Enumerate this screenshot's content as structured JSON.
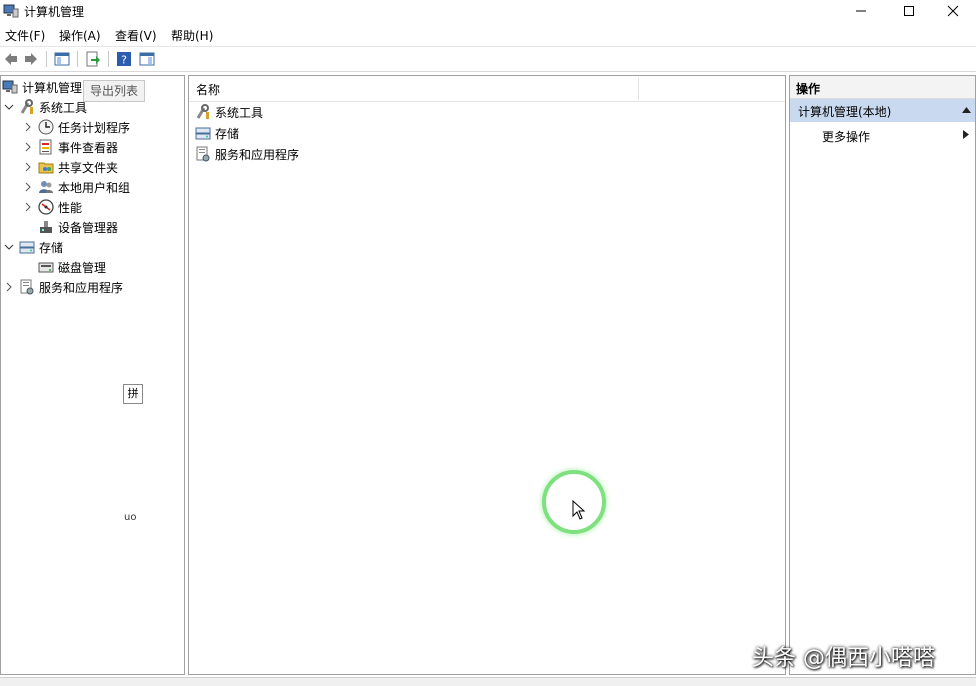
{
  "window": {
    "title": "计算机管理",
    "controls": {
      "minimize": "minimize-icon",
      "maximize": "maximize-icon",
      "close": "close-icon"
    }
  },
  "menubar": [
    {
      "label": "文件(F)"
    },
    {
      "label": "操作(A)"
    },
    {
      "label": "查看(V)"
    },
    {
      "label": "帮助(H)"
    }
  ],
  "toolbar": {
    "buttons": [
      "back-icon",
      "forward-icon",
      "show-hide-console-tree-icon",
      "export-list-icon",
      "help-icon",
      "show-hide-action-pane-icon"
    ]
  },
  "tooltip": "导出列表",
  "tree": {
    "root": "计算机管理",
    "items": [
      {
        "label": "系统工具",
        "expanded": true
      },
      {
        "label": "任务计划程序"
      },
      {
        "label": "事件查看器"
      },
      {
        "label": "共享文件夹"
      },
      {
        "label": "本地用户和组"
      },
      {
        "label": "性能"
      },
      {
        "label": "设备管理器"
      },
      {
        "label": "存储",
        "expanded": true
      },
      {
        "label": "磁盘管理"
      },
      {
        "label": "服务和应用程序"
      }
    ]
  },
  "list": {
    "column_name": "名称",
    "rows": [
      {
        "label": "系统工具"
      },
      {
        "label": "存储"
      },
      {
        "label": "服务和应用程序"
      }
    ]
  },
  "actions": {
    "header": "操作",
    "group": "计算机管理(本地)",
    "item": "更多操作"
  },
  "ime": {
    "mode": "拼",
    "lang": "uo"
  },
  "watermark": "头条 @偶西小嗒嗒",
  "colors": {
    "selection": "#c9daf0",
    "border": "#a0a0a0"
  }
}
